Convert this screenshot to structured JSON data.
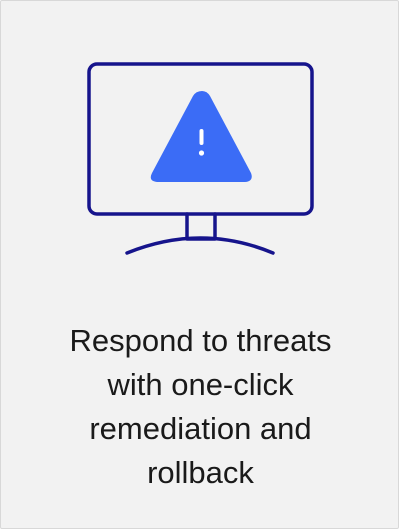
{
  "card": {
    "caption_lines": [
      "Respond to threats",
      "with one-click",
      "remediation and",
      "rollback"
    ]
  },
  "icons": {
    "monitor": "monitor-icon",
    "warning": "warning-triangle-icon"
  },
  "colors": {
    "outline": "#16148c",
    "accent": "#3b6cf6",
    "background": "#f2f2f2",
    "text": "#1a1a1a"
  }
}
